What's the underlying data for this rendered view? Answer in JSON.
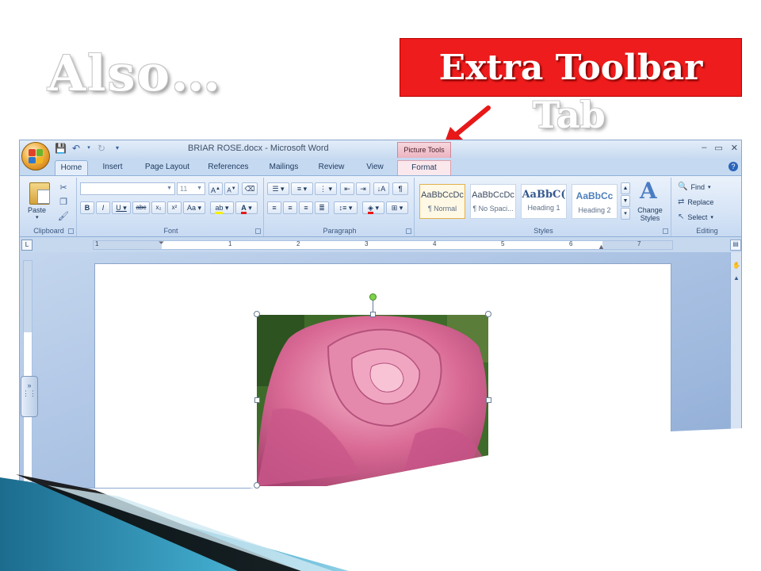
{
  "slide": {
    "title": "Also…",
    "callout": "Extra Toolbar",
    "callout_tab": "Tab"
  },
  "window": {
    "doc_title": "BRIAR ROSE.docx - Microsoft Word",
    "contextual_tab_group": "Picture Tools",
    "controls": [
      "–",
      "▭",
      "✕"
    ]
  },
  "tabs": [
    "Home",
    "Insert",
    "Page Layout",
    "References",
    "Mailings",
    "Review",
    "View",
    "Format"
  ],
  "ribbon": {
    "clipboard": {
      "label": "Clipboard",
      "paste": "Paste"
    },
    "font": {
      "label": "Font",
      "font_size": "11"
    },
    "paragraph": {
      "label": "Paragraph"
    },
    "styles": {
      "label": "Styles",
      "items": [
        {
          "sample": "AaBbCcDc",
          "name": "¶ Normal"
        },
        {
          "sample": "AaBbCcDc",
          "name": "¶ No Spaci..."
        },
        {
          "sample": "AaBbC(",
          "name": "Heading 1"
        },
        {
          "sample": "AaBbCc",
          "name": "Heading 2"
        }
      ],
      "change_styles": "Change Styles"
    },
    "editing": {
      "label": "Editing",
      "find": "Find",
      "replace": "Replace",
      "select": "Select"
    }
  },
  "ruler": {
    "numbers": [
      "1",
      "1",
      "2",
      "3",
      "4",
      "5",
      "6",
      "7"
    ]
  },
  "colors": {
    "callout_red": "#ee1c1c",
    "ribbon_blue": "#c5d9f1",
    "format_tab_pink": "#fbe8ed"
  }
}
